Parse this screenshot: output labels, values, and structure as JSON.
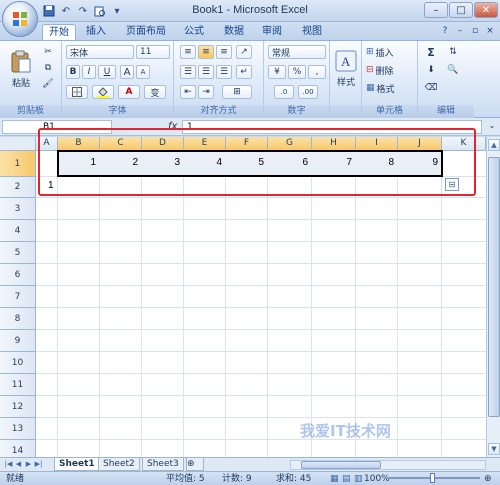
{
  "window": {
    "title": "Book1 - Microsoft Excel",
    "minimize": "–",
    "restore": "□",
    "close": "✕"
  },
  "ribbon_tabs": [
    "开始",
    "插入",
    "页面布局",
    "公式",
    "数据",
    "审阅",
    "视图"
  ],
  "ribbon": {
    "clipboard": {
      "paste_label": "粘贴",
      "group_label": "剪贴板"
    },
    "font": {
      "font_name": "宋体",
      "font_size": "11",
      "bold": "B",
      "italic": "I",
      "underline": "U",
      "grow": "A",
      "shrink": "A",
      "font_color": "A",
      "wen": "变",
      "group_label": "字体"
    },
    "alignment": {
      "group_label": "对齐方式"
    },
    "number": {
      "format": "常规",
      "percent": "%",
      "comma": ",",
      "group_label": "数字"
    },
    "styles": {
      "styles_label": "样式",
      "group_label": ""
    },
    "cells": {
      "insert": "插入",
      "delete": "删除",
      "format": "格式",
      "group_label": "单元格"
    },
    "editing": {
      "sum": "Σ",
      "group_label": "编辑"
    }
  },
  "formula_bar": {
    "name_box": "B1",
    "fx": "fx",
    "formula": "1"
  },
  "columns": [
    "A",
    "B",
    "C",
    "D",
    "E",
    "F",
    "G",
    "H",
    "I",
    "J",
    "K"
  ],
  "rows": [
    "1",
    "2",
    "3",
    "4",
    "5",
    "6",
    "7",
    "8",
    "9",
    "10",
    "11",
    "12",
    "13",
    "14"
  ],
  "cells": {
    "row1": [
      "1",
      "2",
      "3",
      "4",
      "5",
      "6",
      "7",
      "8",
      "9"
    ],
    "a2": "1"
  },
  "sheets": [
    "Sheet1",
    "Sheet2",
    "Sheet3"
  ],
  "status": {
    "ready": "就绪",
    "average": "平均值: 5",
    "count": "计数: 9",
    "sum": "求和: 45",
    "zoom": "100%"
  },
  "watermark": "我爱IT技术网"
}
